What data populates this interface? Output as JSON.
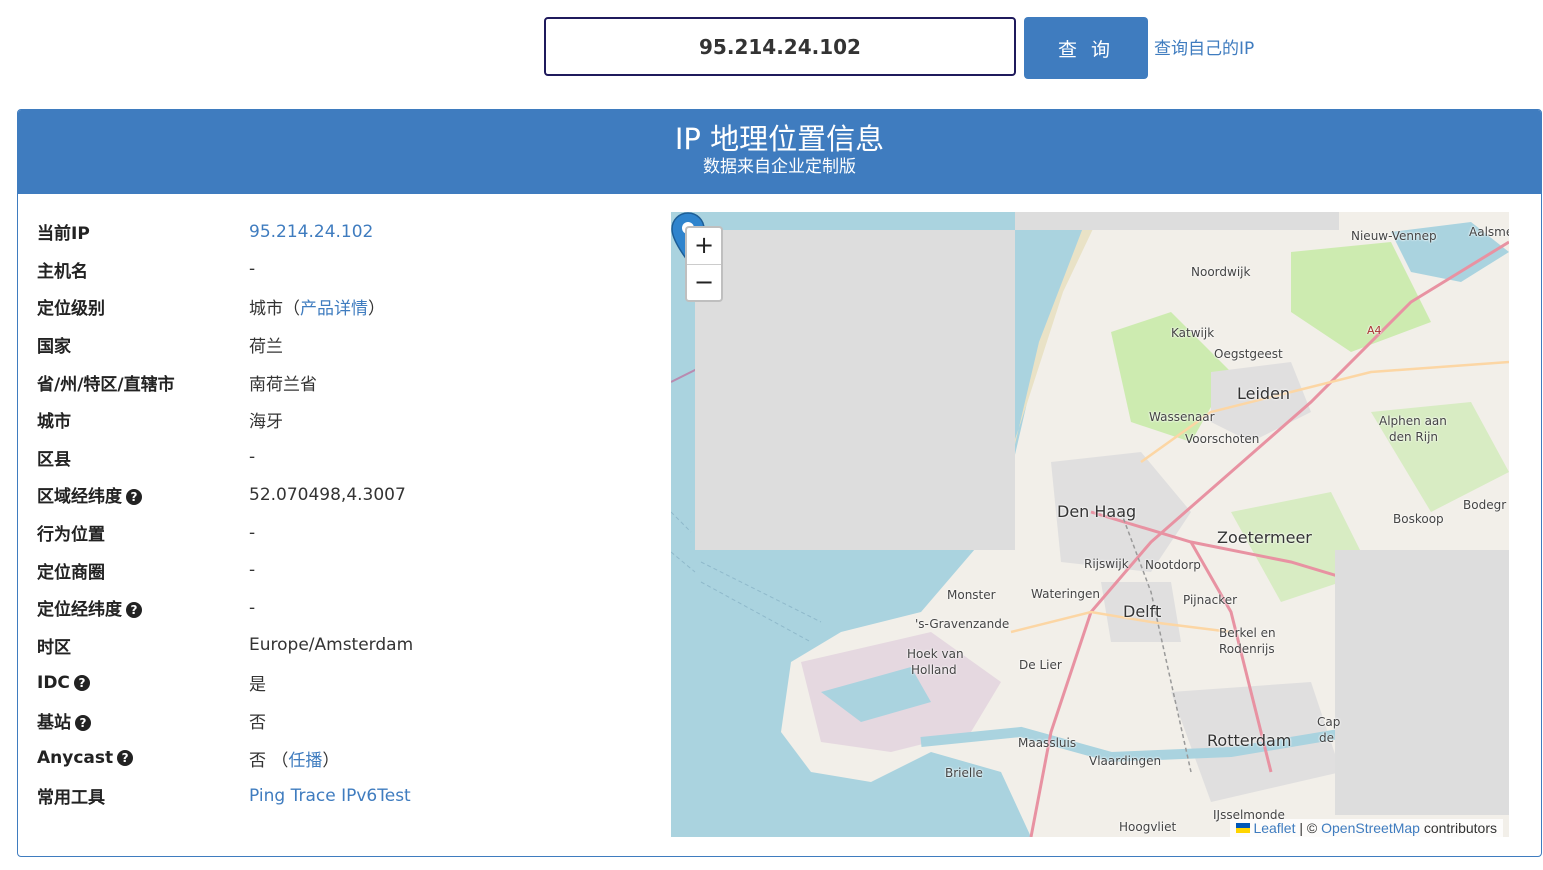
{
  "search": {
    "ip_value": "95.214.24.102",
    "query_label": "查 询",
    "self_ip_link": "查询自己的IP"
  },
  "panel": {
    "title": "IP 地理位置信息",
    "subtitle": "数据来自企业定制版"
  },
  "rows": [
    {
      "label": "当前IP",
      "value": "95.214.24.102",
      "value_link": true
    },
    {
      "label": "主机名",
      "value": "-"
    },
    {
      "label": "定位级别",
      "value": "城市（",
      "link": "产品详情",
      "suffix": "）"
    },
    {
      "label": "国家",
      "value": "荷兰"
    },
    {
      "label": "省/州/特区/直辖市",
      "value": "南荷兰省"
    },
    {
      "label": "城市",
      "value": "海牙"
    },
    {
      "label": "区县",
      "value": "-"
    },
    {
      "label": "区域经纬度",
      "help": true,
      "value": "52.070498,4.3007"
    },
    {
      "label": "行为位置",
      "value": "-"
    },
    {
      "label": "定位商圈",
      "value": "-"
    },
    {
      "label": "定位经纬度",
      "help": true,
      "value": "-"
    },
    {
      "label": "时区",
      "value": "Europe/Amsterdam"
    },
    {
      "label": "IDC",
      "help": true,
      "value": "是"
    },
    {
      "label": "基站",
      "help": true,
      "value": "否"
    },
    {
      "label": "Anycast",
      "help": true,
      "value": "否 （",
      "link": "任播",
      "suffix": "）"
    },
    {
      "label": "常用工具",
      "links": [
        "Ping",
        "Trace",
        "IPv6Test"
      ]
    }
  ],
  "help_glyph": "?",
  "map": {
    "zoom_in": "+",
    "zoom_out": "−",
    "attribution": {
      "leaflet": "Leaflet",
      "sep": " | © ",
      "osm": "OpenStreetMap",
      "tail": " contributors"
    },
    "places": [
      "Nieuw-Vennep",
      "Aalsme",
      "Noordwijk",
      "Katwijk",
      "Oegstgeest",
      "A4",
      "Leiden",
      "Wassenaar",
      "Alphen aan",
      "den Rijn",
      "Voorschoten",
      "Bodegr",
      "Den Haag",
      "Zoetermeer",
      "Boskoop",
      "Rijswijk",
      "Nootdorp",
      "Monster",
      "Wateringen",
      "Delft",
      "Pijnacker",
      "'s-Gravenzande",
      "Berkel en",
      "Rodenrijs",
      "Hoek van",
      "Holland",
      "De Lier",
      "Maassluis",
      "Rotterdam",
      "Cap",
      "de",
      "Vlaardingen",
      "Brielle",
      "Hoogvliet",
      "IJsselmonde"
    ],
    "colors": {
      "water": "#aad3df",
      "land": "#f2efe9",
      "missing": "#dddddd",
      "road": "#e892a2",
      "marker": "#2f84cd"
    }
  }
}
